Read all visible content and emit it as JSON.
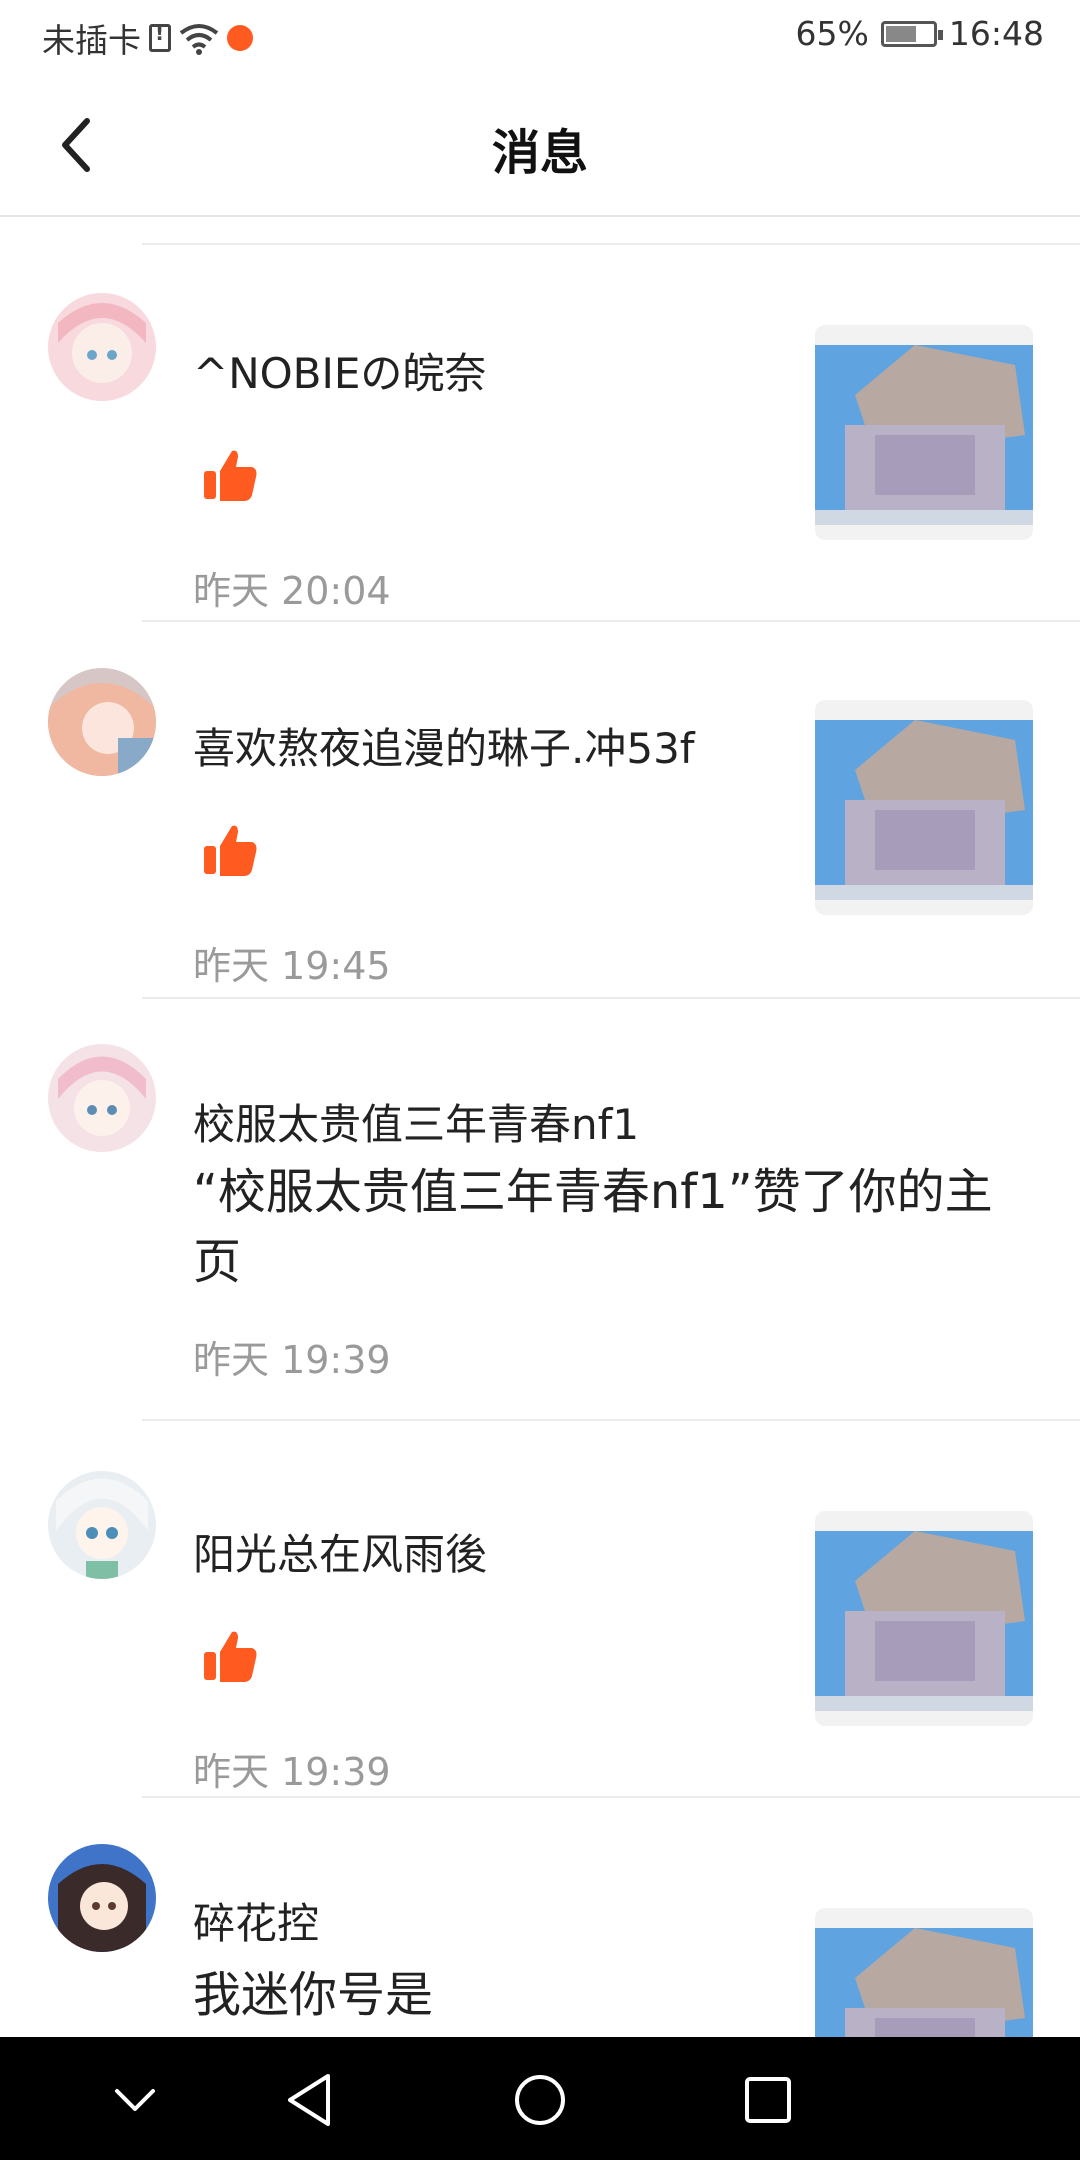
{
  "status": {
    "carrier": "未插卡",
    "battery": "65%",
    "time": "16:48"
  },
  "header": {
    "title": "消息"
  },
  "messages": [
    {
      "user": "^NOBIEの皖奈",
      "type": "like",
      "text": "",
      "time": "昨天 20:04"
    },
    {
      "user": "喜欢熬夜追漫的琳子.冲53f",
      "type": "like",
      "text": "",
      "time": "昨天 19:45"
    },
    {
      "user": "校服太贵值三年青春nf1",
      "type": "text",
      "text": "“校服太贵值三年青春nf1”赞了你的主页",
      "time": "昨天 19:39"
    },
    {
      "user": "阳光总在风雨後",
      "type": "like",
      "text": "",
      "time": "昨天 19:39"
    },
    {
      "user": "碎花控",
      "type": "text",
      "text": "我迷你号是",
      "time": ""
    }
  ],
  "colors": {
    "accent": "#ff5a1f",
    "timestamp": "#9a9a9a"
  }
}
